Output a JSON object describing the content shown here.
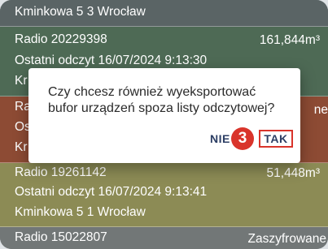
{
  "rows": [
    {
      "line1": "Kminkowa 5 3 Wrocław"
    },
    {
      "line1": "Radio 20229398",
      "value": "161,844m³",
      "line2": "Ostatni odczyt 16/07/2024 9:13:30",
      "line3": "Kr"
    },
    {
      "line1": "Ra",
      "line2": "Os",
      "line3": "Kr",
      "value": "ne"
    },
    {
      "line1": "Radio 19261142",
      "value": "51,448m³",
      "line2": "Ostatni odczyt 16/07/2024 9:13:41",
      "line3": "Kminkowa 5 1 Wrocław"
    },
    {
      "line1": "Radio 15022807",
      "value": "Zaszyfrowane"
    }
  ],
  "dialog": {
    "line1": "Czy chcesz również wyeksportować",
    "line2": "bufor urządzeń spoza listy odczytowej?",
    "no_label": "NIE",
    "yes_label": "TAK",
    "step_badge": "3"
  }
}
